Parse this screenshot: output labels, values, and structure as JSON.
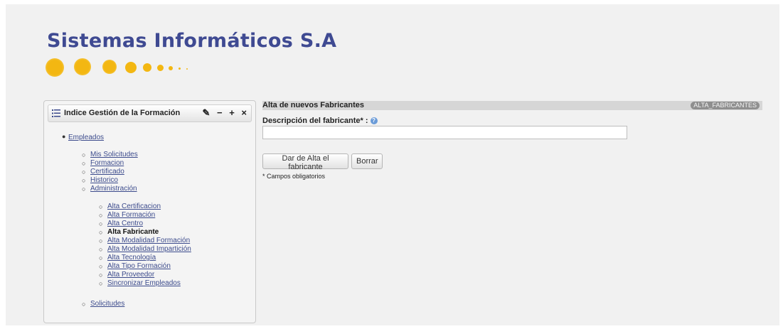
{
  "brand": {
    "title": "Sistemas Informáticos S.A"
  },
  "colors": {
    "brand": "#3f4a92",
    "dots": "#f3b712",
    "link": "#3c4b8c"
  },
  "portlet": {
    "title": "Indice Gestión de la Formación",
    "buttons": {
      "config": "✎",
      "minimize": "−",
      "maximize": "+",
      "close": "×"
    },
    "nav": {
      "empleados": "Empleados",
      "sub": [
        "Mis Solicitudes",
        "Formacion",
        "Certificado",
        "Historico",
        "Administración"
      ],
      "admin": [
        "Alta Certificacion",
        "Alta Formación",
        "Alta Centro"
      ],
      "current": "Alta Fabricante",
      "admin_rest": [
        "Alta Modalidad Formación",
        "Alta Modalidad Impartición",
        "Alta Tecnología",
        "Alta Tipo Formación",
        "Alta Proveedor",
        "Sincronizar Empleados"
      ],
      "solicitudes": "Solicitudes"
    }
  },
  "form": {
    "title": "Alta de nuevos Fabricantes",
    "badge": "ALTA_FABRICANTES",
    "field_label": "Descripción del fabricante* :",
    "field_value": "",
    "submit_label": "Dar de Alta el fabricante",
    "reset_label": "Borrar",
    "required_note": "* Campos obligatorios"
  }
}
